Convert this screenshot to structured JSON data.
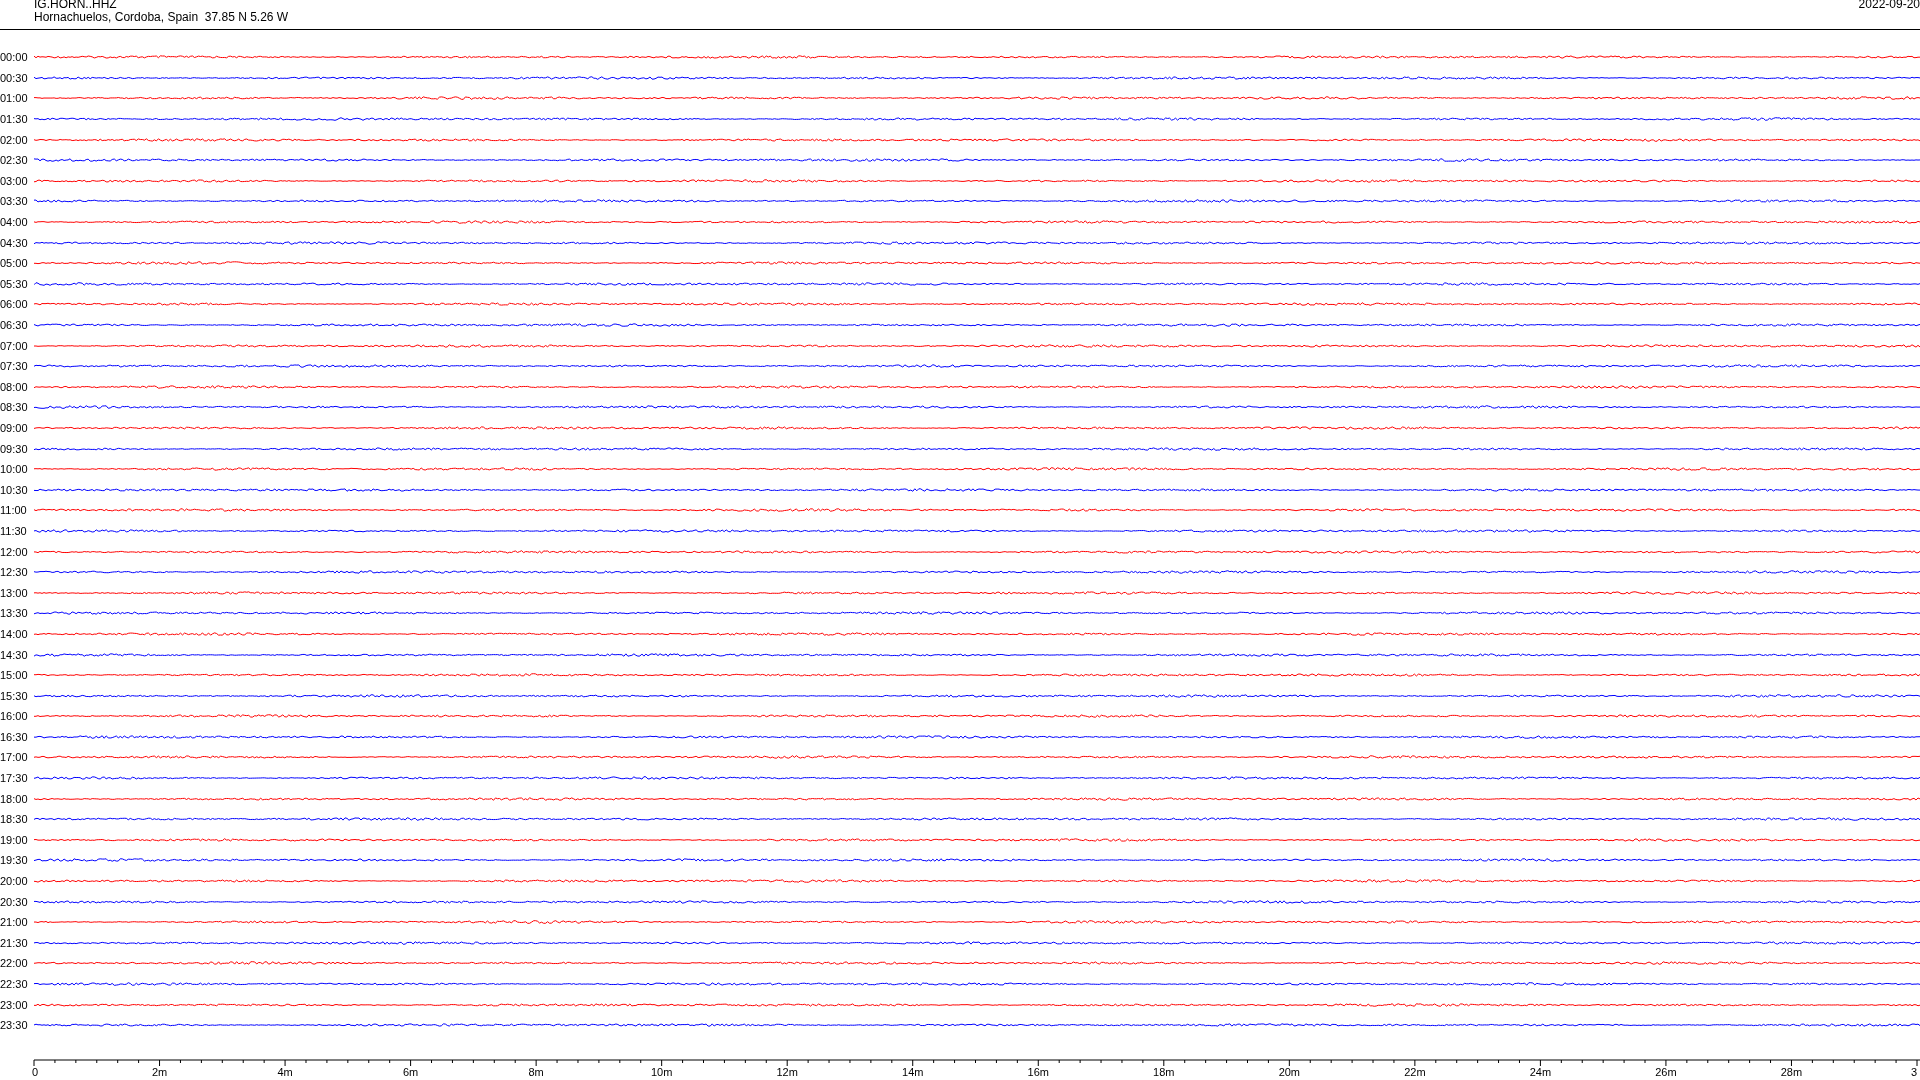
{
  "header": {
    "station": "IG.HORN..HHZ",
    "location": "Hornachuelos, Cordoba, Spain  37.85 N 5.26 W",
    "date": "2022-09-20"
  },
  "rows": [
    {
      "label": "00:00",
      "color": "#ff0000"
    },
    {
      "label": "00:30",
      "color": "#0000ff"
    },
    {
      "label": "01:00",
      "color": "#ff0000"
    },
    {
      "label": "01:30",
      "color": "#0000ff"
    },
    {
      "label": "02:00",
      "color": "#ff0000"
    },
    {
      "label": "02:30",
      "color": "#0000ff"
    },
    {
      "label": "03:00",
      "color": "#ff0000"
    },
    {
      "label": "03:30",
      "color": "#0000ff"
    },
    {
      "label": "04:00",
      "color": "#ff0000"
    },
    {
      "label": "04:30",
      "color": "#0000ff"
    },
    {
      "label": "05:00",
      "color": "#ff0000"
    },
    {
      "label": "05:30",
      "color": "#0000ff"
    },
    {
      "label": "06:00",
      "color": "#ff0000"
    },
    {
      "label": "06:30",
      "color": "#0000ff"
    },
    {
      "label": "07:00",
      "color": "#ff0000"
    },
    {
      "label": "07:30",
      "color": "#0000ff"
    },
    {
      "label": "08:00",
      "color": "#ff0000"
    },
    {
      "label": "08:30",
      "color": "#0000ff"
    },
    {
      "label": "09:00",
      "color": "#ff0000"
    },
    {
      "label": "09:30",
      "color": "#0000ff"
    },
    {
      "label": "10:00",
      "color": "#ff0000"
    },
    {
      "label": "10:30",
      "color": "#0000ff"
    },
    {
      "label": "11:00",
      "color": "#ff0000"
    },
    {
      "label": "11:30",
      "color": "#0000ff"
    },
    {
      "label": "12:00",
      "color": "#ff0000"
    },
    {
      "label": "12:30",
      "color": "#0000ff"
    },
    {
      "label": "13:00",
      "color": "#ff0000"
    },
    {
      "label": "13:30",
      "color": "#0000ff"
    },
    {
      "label": "14:00",
      "color": "#ff0000"
    },
    {
      "label": "14:30",
      "color": "#0000ff"
    },
    {
      "label": "15:00",
      "color": "#ff0000"
    },
    {
      "label": "15:30",
      "color": "#0000ff"
    },
    {
      "label": "16:00",
      "color": "#ff0000"
    },
    {
      "label": "16:30",
      "color": "#0000ff"
    },
    {
      "label": "17:00",
      "color": "#ff0000"
    },
    {
      "label": "17:30",
      "color": "#0000ff"
    },
    {
      "label": "18:00",
      "color": "#ff0000"
    },
    {
      "label": "18:30",
      "color": "#0000ff"
    },
    {
      "label": "19:00",
      "color": "#ff0000"
    },
    {
      "label": "19:30",
      "color": "#0000ff"
    },
    {
      "label": "20:00",
      "color": "#ff0000"
    },
    {
      "label": "20:30",
      "color": "#0000ff"
    },
    {
      "label": "21:00",
      "color": "#ff0000"
    },
    {
      "label": "21:30",
      "color": "#0000ff"
    },
    {
      "label": "22:00",
      "color": "#ff0000"
    },
    {
      "label": "22:30",
      "color": "#0000ff"
    },
    {
      "label": "23:00",
      "color": "#ff0000"
    },
    {
      "label": "23:30",
      "color": "#0000ff"
    }
  ],
  "axis": {
    "labels": [
      "0",
      "2m",
      "4m",
      "6m",
      "8m",
      "10m",
      "12m",
      "14m",
      "16m",
      "18m",
      "20m",
      "22m",
      "24m",
      "26m",
      "28m",
      "3"
    ]
  }
}
